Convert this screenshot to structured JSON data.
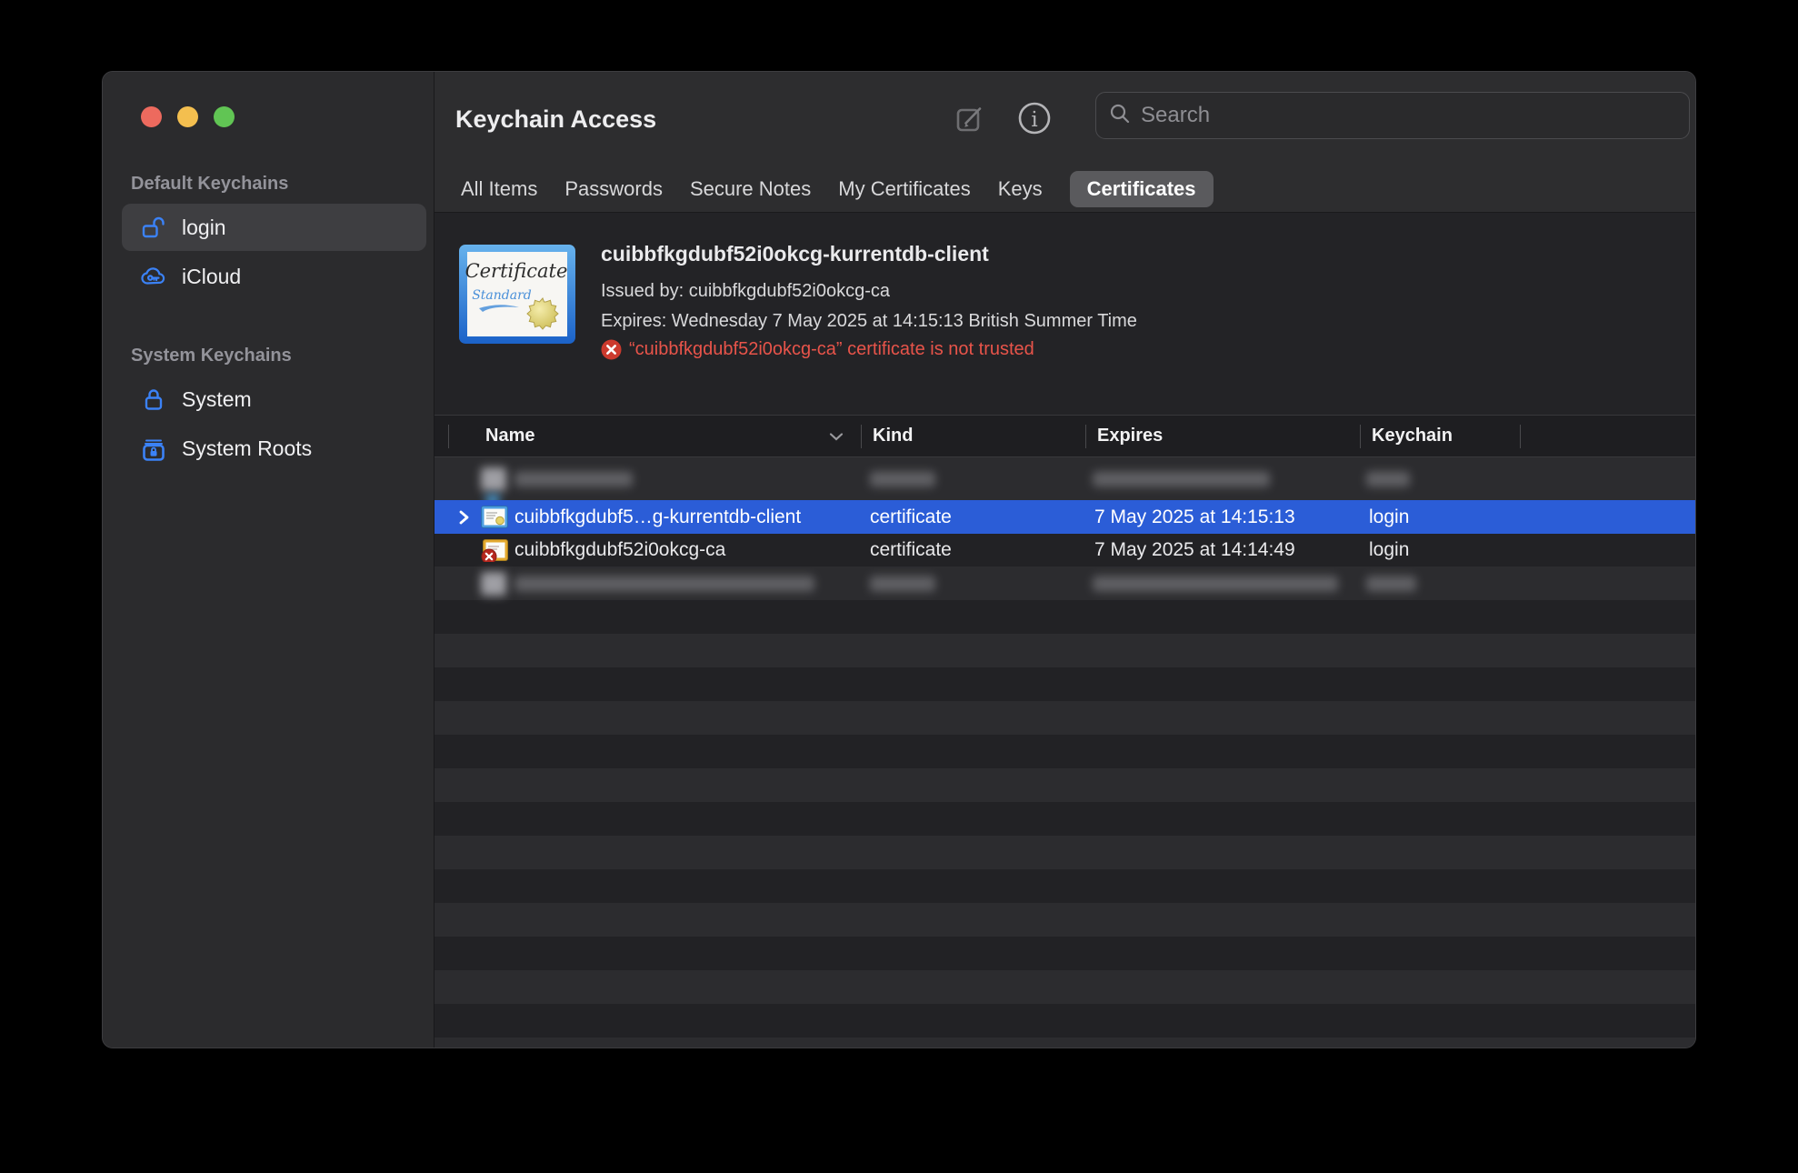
{
  "window_title": "Keychain Access",
  "window_controls": {
    "close": "close",
    "minimize": "minimize",
    "zoom": "zoom"
  },
  "toolbar": {
    "search_placeholder": "Search"
  },
  "tabs": [
    {
      "label": "All Items",
      "active": false
    },
    {
      "label": "Passwords",
      "active": false
    },
    {
      "label": "Secure Notes",
      "active": false
    },
    {
      "label": "My Certificates",
      "active": false
    },
    {
      "label": "Keys",
      "active": false
    },
    {
      "label": "Certificates",
      "active": true
    }
  ],
  "sidebar": {
    "sections": [
      {
        "header": "Default Keychains",
        "items": [
          {
            "label": "login",
            "icon": "unlocked-padlock",
            "selected": true
          },
          {
            "label": "iCloud",
            "icon": "cloud-key",
            "selected": false
          }
        ]
      },
      {
        "header": "System Keychains",
        "items": [
          {
            "label": "System",
            "icon": "locked-padlock",
            "selected": false
          },
          {
            "label": "System Roots",
            "icon": "lockbox",
            "selected": false
          }
        ]
      }
    ]
  },
  "detail": {
    "certificate_image": {
      "title": "Certificate",
      "subtitle": "Standard"
    },
    "name": "cuibbfkgdubf52i0okcg-kurrentdb-client",
    "issued_by": "Issued by: cuibbfkgdubf52i0okcg-ca",
    "expires": "Expires: Wednesday 7 May 2025 at 14:15:13 British Summer Time",
    "trust_warning": "“cuibbfkgdubf52i0okcg-ca” certificate is not trusted"
  },
  "table": {
    "columns": [
      "Name",
      "Kind",
      "Expires",
      "Keychain"
    ],
    "rows": [
      {
        "redacted": true
      },
      {
        "name": "cuibbfkgdubf5…g-kurrentdb-client",
        "kind": "certificate",
        "expires": "7 May 2025 at 14:15:13",
        "keychain": "login",
        "selected": true
      },
      {
        "name": "cuibbfkgdubf52i0okcg-ca",
        "kind": "certificate",
        "expires": "7 May 2025 at 14:14:49",
        "keychain": "login",
        "selected": false
      },
      {
        "redacted": true
      }
    ]
  },
  "colors": {
    "selection_blue": "#2b5dd7",
    "accent_blue": "#3b82f7",
    "warning_red": "#e8544a",
    "traffic_red": "#ed6a5e",
    "traffic_yellow": "#f4bf4f",
    "traffic_green": "#61c554"
  }
}
